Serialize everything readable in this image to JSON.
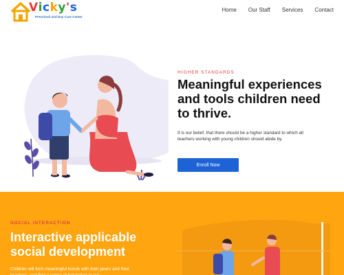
{
  "brand": {
    "name_letters": [
      "V",
      "i",
      "c",
      "k",
      "y",
      "'",
      "s"
    ],
    "name_colors": [
      "#e53935",
      "#2e9d3c",
      "#1e63d6",
      "#f5a300",
      "#2e9d3c",
      "#e53935",
      "#1e63d6"
    ],
    "tagline": "Preschool and Day Care Center"
  },
  "nav": {
    "items": [
      "Home",
      "Our Staff",
      "Services",
      "Contact"
    ]
  },
  "hero": {
    "eyebrow": "HIGHER STANDARDS",
    "headline": "Meaningful experiences and tools children need to thrive.",
    "paragraph": "It is our belief, that there should be a higher standard to which all teachers working with young children should abide by.",
    "cta_label": "Enroll Now"
  },
  "social": {
    "eyebrow": "SOCIAL INTERACTION",
    "headline": "Interactive applicable social development",
    "paragraph": "Children will form meaningful bonds with their peers and their teachers, and find a sense of belonging in our"
  },
  "colors": {
    "accent_blue": "#1e63d6",
    "eyebrow_red": "#e53935",
    "orange_bg": "#ffa50f",
    "eyebrow_pink": "#c2185b"
  },
  "icons": {
    "logo": "house-icon"
  }
}
